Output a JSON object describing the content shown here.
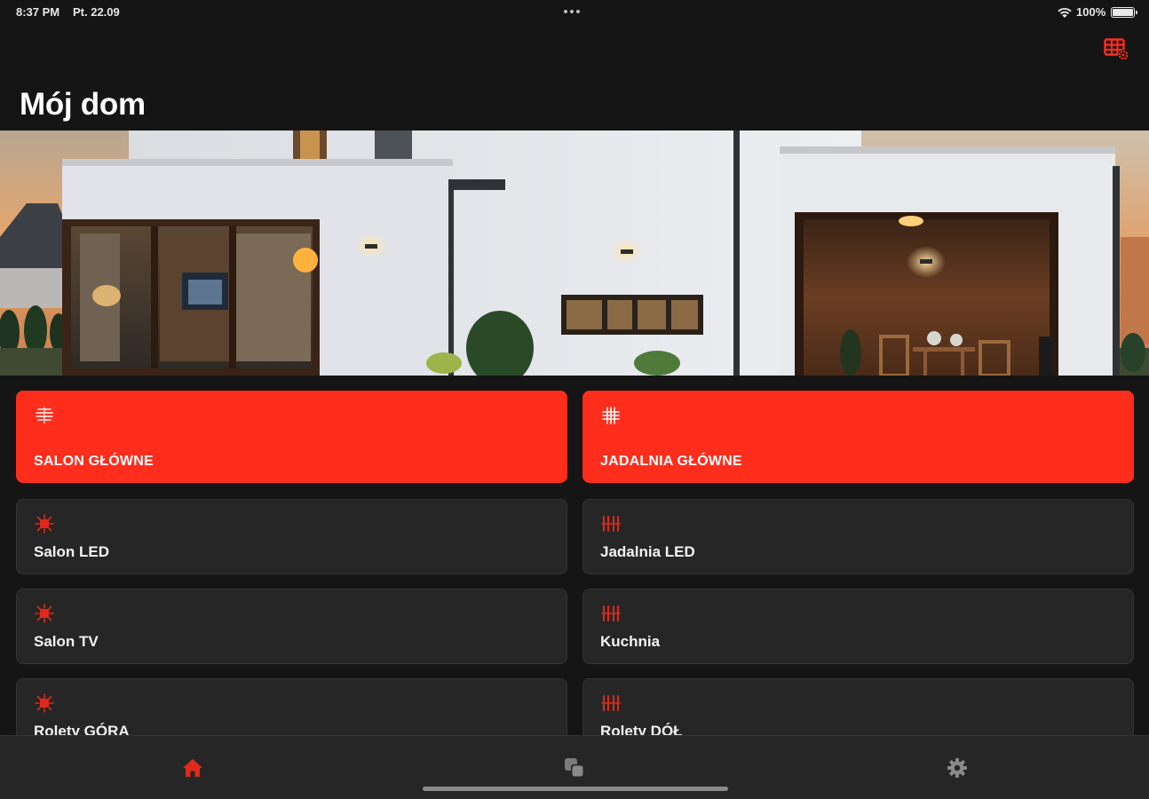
{
  "status": {
    "time": "8:37 PM",
    "date": "Pt. 22.09",
    "battery": "100%"
  },
  "header": {
    "title": "Mój dom",
    "action_icon": "grid-settings-icon"
  },
  "colors": {
    "accent": "#ff2d1c",
    "background": "#151515",
    "tile": "#262626"
  },
  "tiles": [
    {
      "label": "SALON GŁÓWNE",
      "icon": "blinds-icon",
      "active": true
    },
    {
      "label": "JADALNIA GŁÓWNE",
      "icon": "grid-light-icon",
      "active": true
    },
    {
      "label": "Salon LED",
      "icon": "led-sun-icon",
      "active": false
    },
    {
      "label": "Jadalnia LED",
      "icon": "led-strip-icon",
      "active": false
    },
    {
      "label": "Salon TV",
      "icon": "led-sun-icon",
      "active": false
    },
    {
      "label": "Kuchnia",
      "icon": "led-strip-icon",
      "active": false
    },
    {
      "label": "Rolety GÓRA",
      "icon": "led-sun-icon",
      "active": false
    },
    {
      "label": "Rolety DÓŁ",
      "icon": "led-strip-icon",
      "active": false
    }
  ],
  "tabbar": {
    "tabs": [
      {
        "name": "home",
        "icon": "home-icon",
        "selected": true
      },
      {
        "name": "scenes",
        "icon": "scenes-icon",
        "selected": false
      },
      {
        "name": "settings",
        "icon": "gear-icon",
        "selected": false
      }
    ]
  }
}
